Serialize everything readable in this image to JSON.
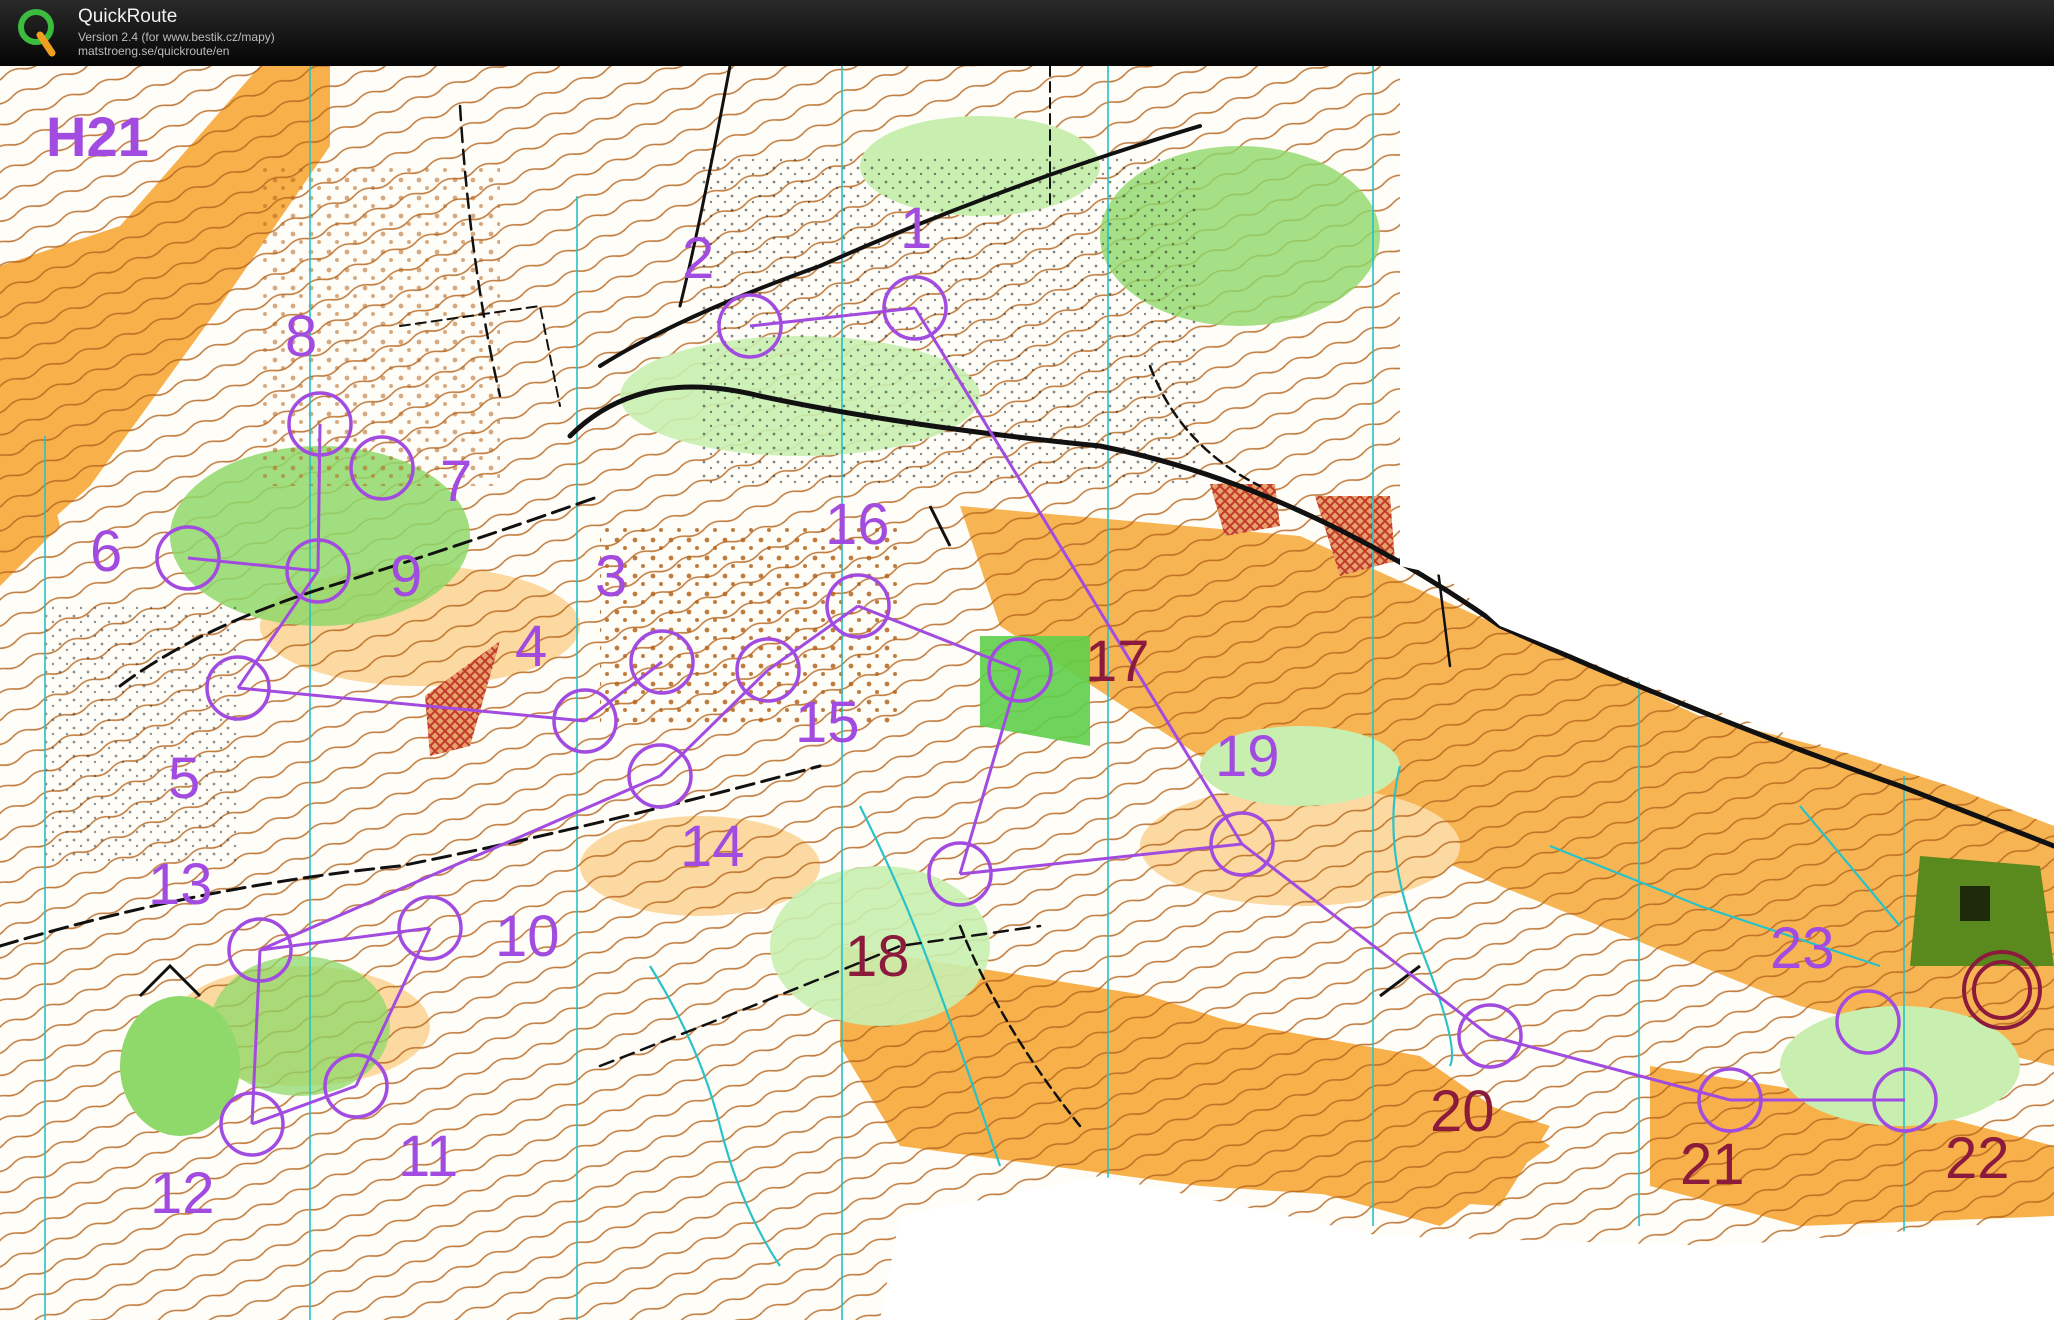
{
  "app": {
    "title": "QuickRoute",
    "version": "Version 2.4  (for www.bestik.cz/mapy)",
    "url": "matstroeng.se/quickroute/en"
  },
  "map": {
    "class_label": "H21",
    "control_color": "#a24be0",
    "highlight_control_color": "#8b1a3c",
    "start_color": "#8b1a3c",
    "controls": [
      {
        "label": "1"
      },
      {
        "label": "2"
      },
      {
        "label": "3"
      },
      {
        "label": "4"
      },
      {
        "label": "5"
      },
      {
        "label": "6"
      },
      {
        "label": "7"
      },
      {
        "label": "8"
      },
      {
        "label": "9"
      },
      {
        "label": "10"
      },
      {
        "label": "11"
      },
      {
        "label": "12"
      },
      {
        "label": "13"
      },
      {
        "label": "14"
      },
      {
        "label": "15"
      },
      {
        "label": "16"
      },
      {
        "label": "17"
      },
      {
        "label": "18"
      },
      {
        "label": "19"
      },
      {
        "label": "20"
      },
      {
        "label": "21"
      },
      {
        "label": "22"
      },
      {
        "label": "23"
      }
    ],
    "colors": {
      "open_land": "#f7b04a",
      "rough_open": "#fcd9a0",
      "forest_green": "#8fd86a",
      "light_green": "#c9efb0",
      "dark_green": "#5a8a1e",
      "contour": "#b5651d",
      "water": "#29c2c8",
      "road": "#111111",
      "out_of_bounds": "#c0392b"
    }
  }
}
